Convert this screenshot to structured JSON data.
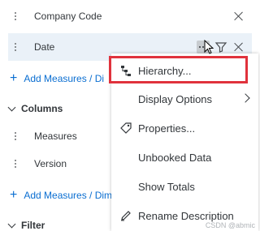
{
  "rows": {
    "company_code": "Company Code",
    "date": "Date",
    "measures": "Measures",
    "version": "Version"
  },
  "add_links": {
    "rows_add": "Add Measures / Di",
    "columns_add": "Add Measures / Dim"
  },
  "sections": {
    "columns": "Columns",
    "filter": "Filter"
  },
  "menu": {
    "items": [
      {
        "label": "Hierarchy...",
        "icon": "hierarchy-icon"
      },
      {
        "label": "Display Options",
        "icon": "",
        "submenu": true
      },
      {
        "label": "Properties...",
        "icon": "tag-icon"
      },
      {
        "label": "Unbooked Data",
        "icon": ""
      },
      {
        "label": "Show Totals",
        "icon": ""
      },
      {
        "label": "Rename Description",
        "icon": "pencil-icon"
      }
    ]
  },
  "colors": {
    "accent": "#0a6ed1",
    "highlight": "#e0323c",
    "selected_row": "#eaf1f8"
  },
  "watermark": "CSDN @abmic"
}
